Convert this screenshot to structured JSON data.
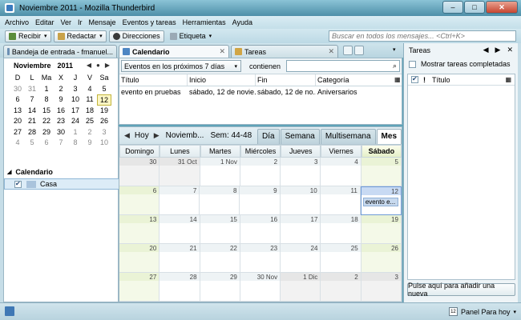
{
  "window": {
    "title": "Noviembre 2011 - Mozilla Thunderbird",
    "buttons": [
      "–",
      "□",
      "✕"
    ]
  },
  "menu": [
    "Archivo",
    "Editar",
    "Ver",
    "Ir",
    "Mensaje",
    "Eventos y tareas",
    "Herramientas",
    "Ayuda"
  ],
  "toolbar": {
    "recibir": "Recibir",
    "redactar": "Redactar",
    "direcciones": "Direcciones",
    "etiqueta": "Etiqueta",
    "search_placeholder": "Buscar en todos los mensajes... <Ctrl+K>"
  },
  "tabs": {
    "inbox": "Bandeja de entrada - fmanuel...",
    "calendar": "Calendario",
    "tasks": "Tareas"
  },
  "minimonth": {
    "month": "Noviembre",
    "year": "2011",
    "days": [
      "Do",
      "Lu",
      "Ma",
      "Mi",
      "Ju",
      "Vi",
      "Sa"
    ],
    "day_headers": [
      "D",
      "L",
      "Ma",
      "X",
      "J",
      "V",
      "Sa"
    ],
    "weeks": [
      [
        "30",
        "31",
        "1",
        "2",
        "3",
        "4",
        "5"
      ],
      [
        "6",
        "7",
        "8",
        "9",
        "10",
        "11",
        "12"
      ],
      [
        "13",
        "14",
        "15",
        "16",
        "17",
        "18",
        "19"
      ],
      [
        "20",
        "21",
        "22",
        "23",
        "24",
        "25",
        "26"
      ],
      [
        "27",
        "28",
        "29",
        "30",
        "1",
        "2",
        "3"
      ],
      [
        "4",
        "5",
        "6",
        "7",
        "8",
        "9",
        "10"
      ]
    ],
    "today": "12"
  },
  "calendars": {
    "title": "Calendario",
    "items": [
      {
        "name": "Casa",
        "checked": true,
        "color": "#a9c3dc"
      }
    ]
  },
  "unifinder": {
    "filter": "Eventos en los próximos 7 días",
    "contains_label": "contienen",
    "columns": [
      "Título",
      "Inicio",
      "Fin",
      "Categoría"
    ],
    "rows": [
      [
        "evento en pruebas",
        "sábado, 12 de novie...",
        "sábado, 12 de no...",
        "Aniversarios"
      ]
    ]
  },
  "calnav": {
    "today": "Hoy",
    "month": "Noviemb...",
    "week": "Sem: 44-48",
    "views": [
      "Día",
      "Semana",
      "Multisemana",
      "Mes"
    ],
    "active_view": "Mes"
  },
  "month_view": {
    "weekdays": [
      "Domingo",
      "Lunes",
      "Martes",
      "Miércoles",
      "Jueves",
      "Viernes",
      "Sábado"
    ],
    "weeks": [
      [
        "30",
        "31 Oct",
        "1 Nov",
        "2",
        "3",
        "4",
        "5"
      ],
      [
        "6",
        "7",
        "8",
        "9",
        "10",
        "11",
        "12"
      ],
      [
        "13",
        "14",
        "15",
        "16",
        "17",
        "18",
        "19"
      ],
      [
        "20",
        "21",
        "22",
        "23",
        "24",
        "25",
        "26"
      ],
      [
        "27",
        "28",
        "29",
        "30 Nov",
        "1 Dic",
        "2",
        "3"
      ]
    ],
    "event": {
      "label": "evento e...",
      "day": "12"
    }
  },
  "tasks": {
    "title": "Tareas",
    "show_completed": "Mostrar tareas completadas",
    "col_title": "Título",
    "add_button": "Pulse aquí para añadir una nueva"
  },
  "status": {
    "panel_today": "Panel Para hoy"
  },
  "colors": {
    "accent": "#3a7bbf",
    "today_border": "#6c9ad6",
    "weekend": "#f4f9e8"
  }
}
